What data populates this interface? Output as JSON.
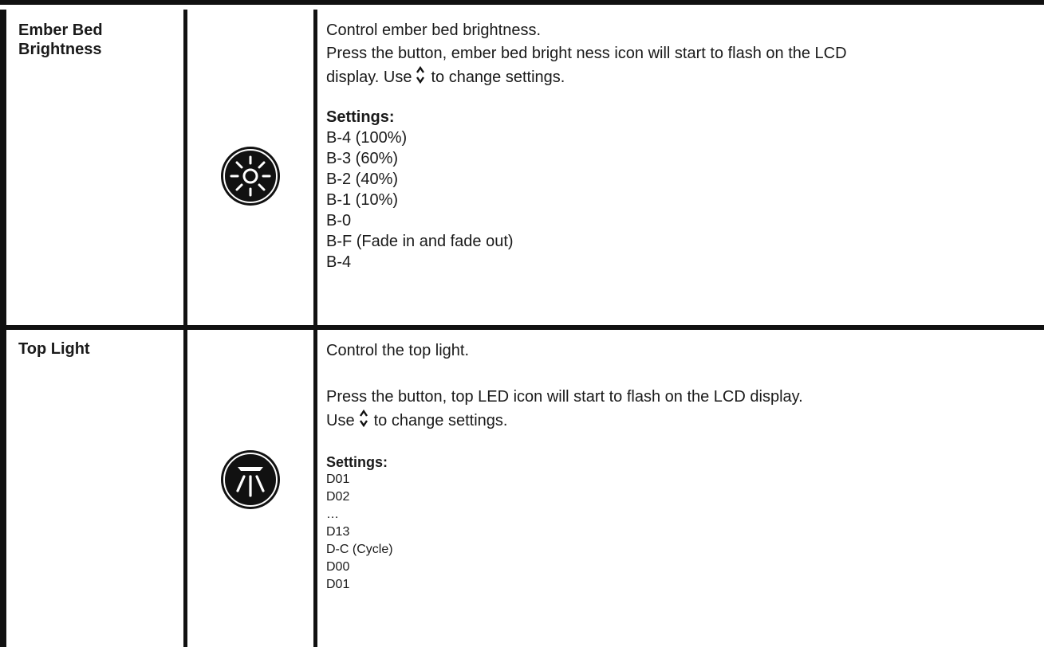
{
  "rows": [
    {
      "label": "Ember Bed Brightness",
      "icon": "sun-brightness-icon",
      "lines": [
        "Control ember bed brightness.",
        "Press the button, ember bed bright ness icon will start to flash on the LCD",
        "display. Use",
        "to change settings."
      ],
      "settings_title": "Settings:",
      "settings": [
        "B-4 (100%)",
        "B-3 (60%)",
        "B-2 (40%)",
        "B-1 (10%)",
        "B-0",
        "B-F (Fade in and fade out)",
        "B-4"
      ]
    },
    {
      "label": "Top Light",
      "icon": "top-light-icon",
      "lines": [
        "Control the top light.",
        "Press the button, top LED icon will start to flash on the LCD display.",
        "Use",
        "to change settings."
      ],
      "settings_title": "Settings:",
      "settings": [
        "D01",
        "D02",
        "…",
        "D13",
        "D-C (Cycle)",
        "D00",
        "D01"
      ]
    }
  ]
}
